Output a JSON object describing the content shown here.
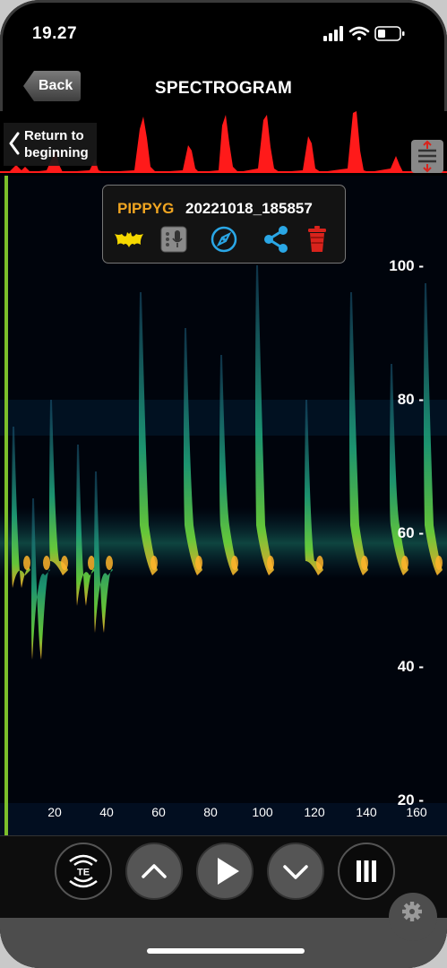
{
  "status_bar": {
    "time": "19.27"
  },
  "nav": {
    "back_label": "Back",
    "title": "SPECTROGRAM"
  },
  "return_button": {
    "line1": "Return to",
    "line2": "beginning"
  },
  "recording_popup": {
    "species": "PIPPYG",
    "filename": "20221018_185857",
    "icons": [
      "bat-icon",
      "recorder-icon",
      "compass-icon",
      "share-icon",
      "trash-icon"
    ]
  },
  "frequency_axis": {
    "ticks": [
      {
        "label": "100 -",
        "value": 100
      },
      {
        "label": "80 -",
        "value": 80
      },
      {
        "label": "60 -",
        "value": 60
      },
      {
        "label": "40 -",
        "value": 40
      },
      {
        "label": "20 -",
        "value": 20
      }
    ]
  },
  "time_axis": {
    "ticks": [
      {
        "label": "20",
        "value": 20
      },
      {
        "label": "40",
        "value": 40
      },
      {
        "label": "60",
        "value": 60
      },
      {
        "label": "80",
        "value": 80
      },
      {
        "label": "100",
        "value": 100
      },
      {
        "label": "120",
        "value": 120
      },
      {
        "label": "140",
        "value": 140
      },
      {
        "label": "160",
        "value": 160
      }
    ]
  },
  "controls": {
    "te_label": "TE",
    "buttons": [
      "te-mode-button",
      "up-button",
      "play-button",
      "down-button",
      "pause-button"
    ]
  },
  "colors": {
    "accent_species": "#f0a521",
    "waveform": "#ff1a1a",
    "position_marker": "#7cbf2a",
    "popup_icon_blue": "#2aa7e6",
    "trash_red": "#d9231c"
  }
}
